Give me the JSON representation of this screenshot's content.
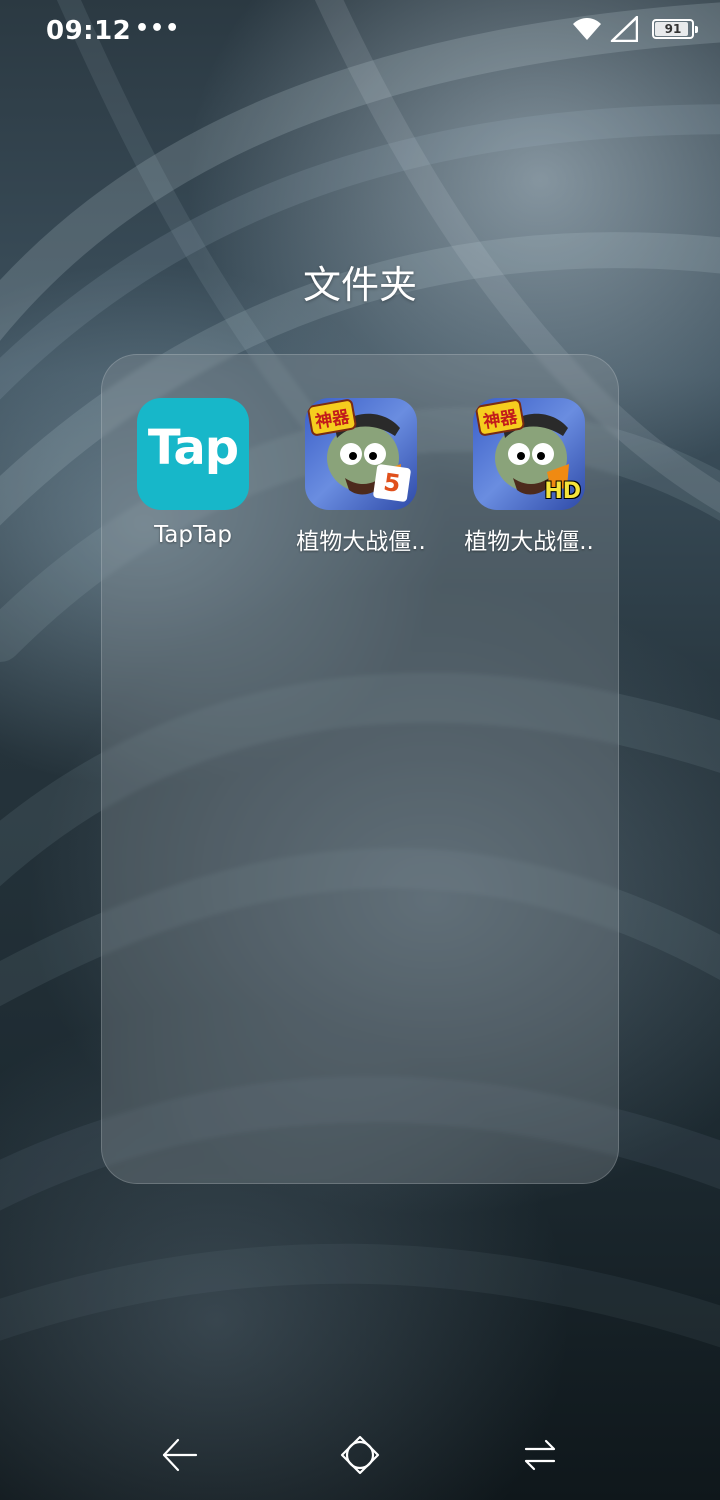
{
  "status_bar": {
    "time": "09:12",
    "more": "•••",
    "battery_level": 91,
    "battery_text": "91",
    "wifi_icon": "wifi-icon",
    "signal_icon": "signal-icon"
  },
  "folder": {
    "title": "文件夹",
    "apps": [
      {
        "label": "TapTap",
        "icon": "taptap-icon",
        "icon_text": "Tap",
        "color": "#17b7c9"
      },
      {
        "label": "植物大战僵..",
        "icon": "pvz-icon",
        "badge_text": "神器",
        "corner_text": "5"
      },
      {
        "label": "植物大战僵..",
        "icon": "pvz-hd-icon",
        "badge_text": "神器",
        "corner_text": "HD"
      }
    ]
  },
  "nav_bar": {
    "back_icon": "back-icon",
    "home_icon": "home-icon",
    "recents_icon": "recents-icon"
  }
}
